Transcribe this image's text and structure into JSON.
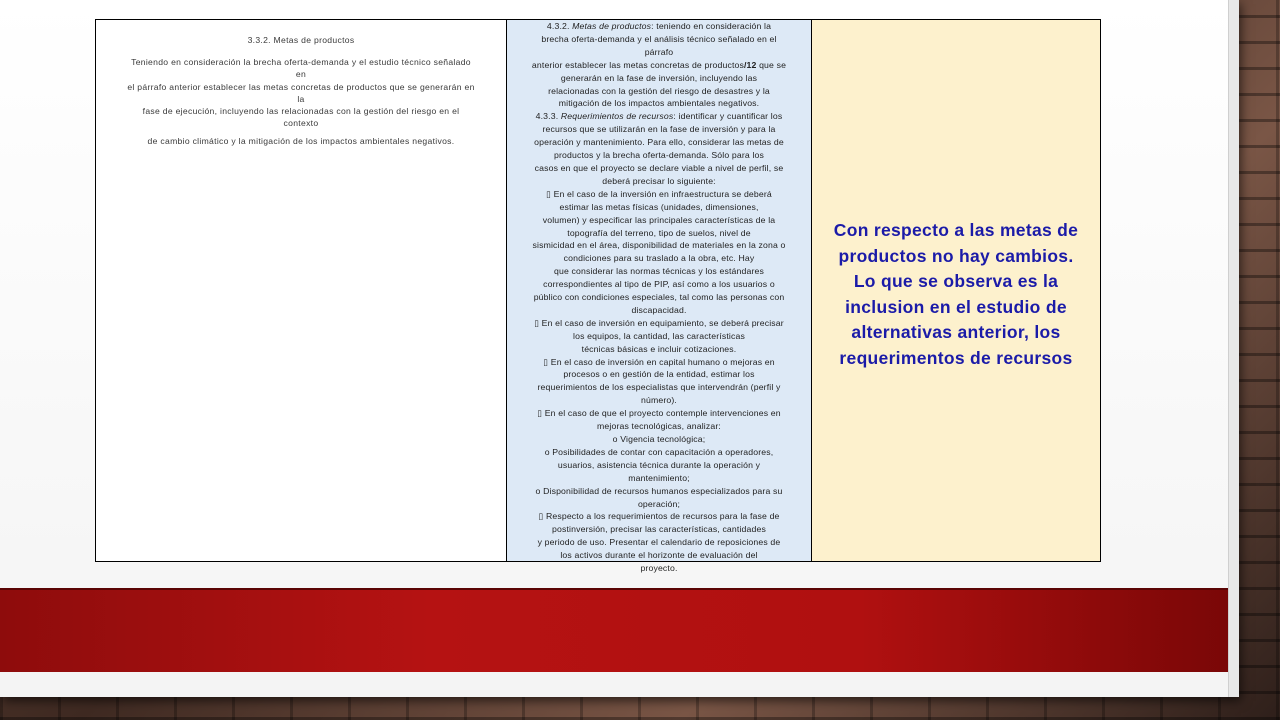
{
  "left_column": {
    "title": "3.3.2. Metas de productos",
    "paragraph_lines": [
      "Teniendo en consideración la brecha oferta-demanda y el estudio técnico señalado",
      "en",
      "el párrafo anterior establecer las metas concretas de productos que se generarán en",
      "la",
      "fase de ejecución, incluyendo las relacionadas con la gestión del riesgo en el",
      "contexto"
    ],
    "last_line": "de cambio climático y la mitigación de los impactos ambientales negativos."
  },
  "middle_column": {
    "lines": [
      {
        "pre": "4.3.2. ",
        "italic": "Metas de productos",
        "post": ": teniendo en consideración la"
      },
      {
        "text": "brecha oferta-demanda y el análisis técnico señalado en el"
      },
      {
        "text": "párrafo"
      },
      {
        "pre": "anterior establecer las metas concretas de productos",
        "bold": "/12",
        "post": " que se"
      },
      {
        "text": "generarán en la fase de inversión, incluyendo las"
      },
      {
        "text": "relacionadas con la gestión del riesgo de desastres y la"
      },
      {
        "text": "mitigación de los impactos ambientales negativos."
      },
      {
        "pre": "4.3.3. ",
        "italic": "Requerimientos de recursos",
        "post": ": identificar y cuantificar los"
      },
      {
        "text": "recursos que se utilizarán en la fase de inversión y para la"
      },
      {
        "text": "operación y mantenimiento. Para ello, considerar las metas de"
      },
      {
        "text": "productos y la brecha oferta-demanda. Sólo para los"
      },
      {
        "text": "casos en que el proyecto se declare viable a nivel de perfil, se"
      },
      {
        "text": "deberá precisar lo siguiente:"
      },
      {
        "text": "▯ En el caso de la inversión en infraestructura se deberá"
      },
      {
        "text": "estimar las metas físicas (unidades, dimensiones,"
      },
      {
        "text": "volumen) y especificar las principales características de la"
      },
      {
        "text": "topografía del terreno, tipo de suelos, nivel de"
      },
      {
        "text": "sismicidad en el área, disponibilidad de materiales en la zona o"
      },
      {
        "text": "condiciones para su traslado a la obra, etc. Hay"
      },
      {
        "text": "que considerar las normas técnicas y los estándares"
      },
      {
        "text": "correspondientes al tipo de PIP, así como a los usuarios o"
      },
      {
        "text": "público con condiciones especiales, tal como las personas con"
      },
      {
        "text": "discapacidad."
      },
      {
        "text": "▯ En el caso de inversión en equipamiento, se deberá precisar"
      },
      {
        "text": "los equipos, la cantidad, las características"
      },
      {
        "text": "técnicas básicas e incluir cotizaciones."
      },
      {
        "text": "▯ En el caso de inversión en capital humano o mejoras en"
      },
      {
        "text": "procesos o en gestión de la entidad, estimar los"
      },
      {
        "text": "requerimientos de los especialistas que intervendrán (perfil y"
      },
      {
        "text": "número)."
      },
      {
        "text": "▯ En el caso de que el proyecto contemple intervenciones en"
      },
      {
        "text": "mejoras tecnológicas, analizar:"
      },
      {
        "text": "o Vigencia tecnológica;"
      },
      {
        "text": "o Posibilidades de contar con capacitación a operadores,"
      },
      {
        "text": "usuarios, asistencia técnica durante la operación y"
      },
      {
        "text": "mantenimiento;"
      },
      {
        "text": "o Disponibilidad de recursos humanos especializados para su"
      },
      {
        "text": "operación;"
      },
      {
        "text": "▯ Respecto a los requerimientos de recursos para la fase de"
      },
      {
        "text": "postinversión, precisar las características, cantidades"
      },
      {
        "text": "y periodo de uso. Presentar el calendario de reposiciones de"
      },
      {
        "text": "los activos durante el horizonte de evaluación del"
      },
      {
        "text": "proyecto."
      }
    ]
  },
  "right_column": {
    "lines": [
      "Con  respecto a las metas de",
      "productos no hay cambios.",
      "Lo que se observa es la",
      "inclusion en el estudio de",
      "alternativas anterior, los",
      "requerimentos de recursos"
    ],
    "text_color": "#1b1ba8"
  },
  "colors": {
    "middle_bg": "#dde9f6",
    "right_bg": "#fdf1cd",
    "bar": "#b51212"
  }
}
